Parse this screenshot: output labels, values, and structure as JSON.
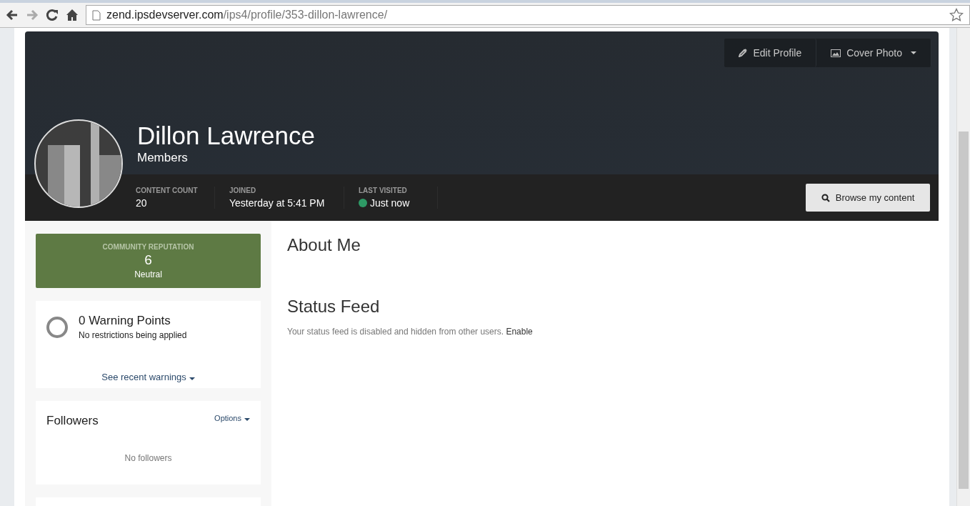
{
  "browser": {
    "url_host": "zend.ipsdevserver.com",
    "url_path": "/ips4/profile/353-dillon-lawrence/"
  },
  "cover": {
    "buttons": [
      {
        "label": "Edit Profile",
        "kind": "edit",
        "caret": false
      },
      {
        "label": "Cover Photo",
        "kind": "photo",
        "caret": true
      }
    ],
    "name": "Dillon Lawrence",
    "group": "Members",
    "stats": [
      {
        "label": "CONTENT COUNT",
        "value": "20",
        "online": false
      },
      {
        "label": "JOINED",
        "value": "Yesterday at 5:41 PM",
        "online": false
      },
      {
        "label": "LAST VISITED",
        "value": "Just now",
        "online": true
      }
    ],
    "browse_button": "Browse my content"
  },
  "reputation": {
    "label": "COMMUNITY REPUTATION",
    "value": "6",
    "tone": "Neutral"
  },
  "warnings": {
    "title": "0 Warning Points",
    "subtitle": "No restrictions being applied",
    "link": "See recent warnings"
  },
  "followers": {
    "title": "Followers",
    "options": "Options",
    "empty": "No followers"
  },
  "main": {
    "about_heading": "About Me",
    "status_heading": "Status Feed",
    "status_text": "Your status feed is disabled and hidden from other users.",
    "status_link": "Enable"
  }
}
